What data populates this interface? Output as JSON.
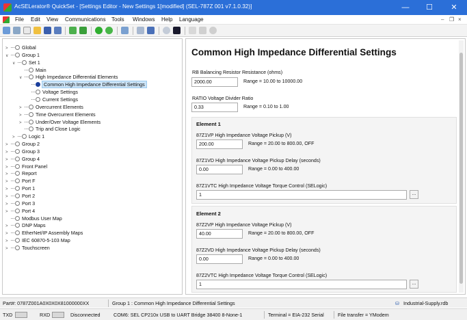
{
  "window": {
    "title": "AcSELerator® QuickSet - [Settings Editor - New Settings 1[modified] (SEL-787Z 001 v7.1.0.32)]",
    "minimize": "—",
    "maximize": "☐",
    "close": "✕"
  },
  "menubar": {
    "items": [
      "File",
      "Edit",
      "View",
      "Communications",
      "Tools",
      "Windows",
      "Help",
      "Language"
    ],
    "mdi_minimize": "–",
    "mdi_restore": "❐",
    "mdi_close": "×"
  },
  "tree": [
    {
      "label": "Global",
      "level": 0,
      "exp": ">"
    },
    {
      "label": "Group 1",
      "level": 0,
      "exp": "∨"
    },
    {
      "label": "Set 1",
      "level": 1,
      "exp": "∨"
    },
    {
      "label": "Main",
      "level": 2,
      "exp": ""
    },
    {
      "label": "High Impedance Differential Elements",
      "level": 2,
      "exp": "∨"
    },
    {
      "label": "Common High Impedance Differential Settings",
      "level": 3,
      "exp": "",
      "selected": true
    },
    {
      "label": "Voltage Settings",
      "level": 3,
      "exp": ""
    },
    {
      "label": "Current Settings",
      "level": 3,
      "exp": ""
    },
    {
      "label": "Overcurrent Elements",
      "level": 2,
      "exp": ">"
    },
    {
      "label": "Time Overcurrent Elements",
      "level": 2,
      "exp": ">"
    },
    {
      "label": "Under/Over Voltage Elements",
      "level": 2,
      "exp": ">"
    },
    {
      "label": "Trip and Close Logic",
      "level": 2,
      "exp": ""
    },
    {
      "label": "Logic 1",
      "level": 1,
      "exp": ">"
    },
    {
      "label": "Group 2",
      "level": 0,
      "exp": ">"
    },
    {
      "label": "Group 3",
      "level": 0,
      "exp": ">"
    },
    {
      "label": "Group 4",
      "level": 0,
      "exp": ">"
    },
    {
      "label": "Front Panel",
      "level": 0,
      "exp": ">"
    },
    {
      "label": "Report",
      "level": 0,
      "exp": ">"
    },
    {
      "label": "Port F",
      "level": 0,
      "exp": ">"
    },
    {
      "label": "Port 1",
      "level": 0,
      "exp": ">"
    },
    {
      "label": "Port 2",
      "level": 0,
      "exp": ">"
    },
    {
      "label": "Port 3",
      "level": 0,
      "exp": ">"
    },
    {
      "label": "Port 4",
      "level": 0,
      "exp": ">"
    },
    {
      "label": "Modbus User Map",
      "level": 0,
      "exp": ""
    },
    {
      "label": "DNP Maps",
      "level": 0,
      "exp": ">"
    },
    {
      "label": "EtherNet/IP Assembly Maps",
      "level": 0,
      "exp": ">"
    },
    {
      "label": "IEC 60870-5-103 Map",
      "level": 0,
      "exp": ">"
    },
    {
      "label": "Touchscreen",
      "level": 0,
      "exp": ">"
    }
  ],
  "editor": {
    "title": "Common High Impedance Differential Settings",
    "rb": {
      "label": "RB  Balancing Resistor Resistance (ohms)",
      "value": "2000.00",
      "range": "Range = 10.00 to 10000.00"
    },
    "ratio": {
      "label": "RATIO  Voltage Divider Ratio",
      "value": "0.33",
      "range": "Range = 0.10 to 1.00"
    },
    "element1": {
      "title": "Element 1",
      "vp": {
        "label": "87Z1VP  High Impedance Voltage Pickup (V)",
        "value": "200.00",
        "range": "Range = 20.00 to 800.00, OFF"
      },
      "vd": {
        "label": "87Z1VD  High Impedance Voltage Pickup Delay (seconds)",
        "value": "0.00",
        "range": "Range = 0.00 to 400.00"
      },
      "vtc": {
        "label": "87Z1VTC  High Impedance Voltage Torque Control (SELogic)",
        "value": "1",
        "button": "..."
      }
    },
    "element2": {
      "title": "Element 2",
      "vp": {
        "label": "87Z2VP  High Impedance Voltage Pickup (V)",
        "value": "40.00",
        "range": "Range = 20.00 to 800.00, OFF"
      },
      "vd": {
        "label": "87Z2VD  High Impedance Voltage Pickup Delay (seconds)",
        "value": "0.00",
        "range": "Range = 0.00 to 400.00"
      },
      "vtc": {
        "label": "87Z2VTC  High Impedance Voltage Torque Control (SELogic)",
        "value": "1",
        "button": "..."
      }
    }
  },
  "status1": {
    "part": "Part#: 0787Z001A0X0X0X81000000XX",
    "path": "Group 1 : Common High Impedance Differential Settings",
    "file": "Industrial-Supply.rdb"
  },
  "status2": {
    "txd": "TXD",
    "rxd": "RXD",
    "conn": "Disconnected",
    "port": "COM6: SEL CP210x USB to UART Bridge  38400  8-None-1",
    "terminal": "Terminal = EIA-232 Serial",
    "transfer": "File transfer = YModem"
  }
}
